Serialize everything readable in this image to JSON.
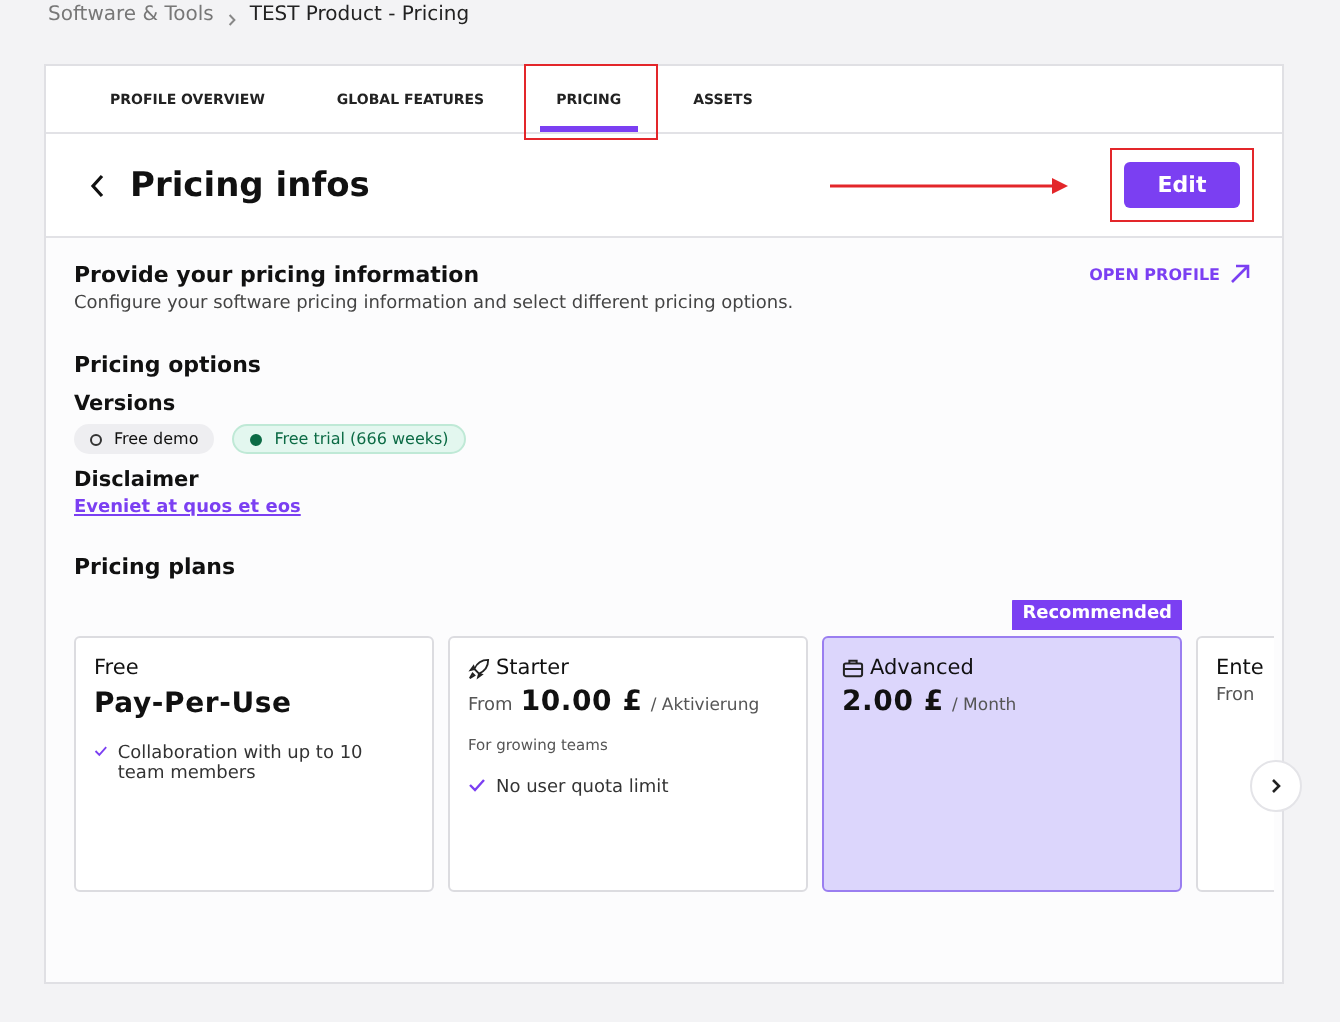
{
  "breadcrumb": [
    {
      "label": "Software & Tools",
      "current": false
    },
    {
      "label": "TEST Product - Pricing",
      "current": true
    }
  ],
  "tabs": [
    {
      "label": "PROFILE OVERVIEW",
      "selected": false
    },
    {
      "label": "GLOBAL FEATURES",
      "selected": false
    },
    {
      "label": "PRICING",
      "selected": true,
      "highlighted": true
    },
    {
      "label": "ASSETS",
      "selected": false
    }
  ],
  "header": {
    "title": "Pricing infos",
    "edit_button": "Edit",
    "edit_highlighted": true
  },
  "intro": {
    "title": "Provide your pricing information",
    "text": "Configure your software pricing information and select different pricing options.",
    "link": "OPEN PROFILE"
  },
  "pricing_options": {
    "title": "Pricing options",
    "versions_title": "Versions",
    "versions": [
      {
        "label": "Free demo",
        "active": false
      },
      {
        "label": "Free trial (666 weeks)",
        "active": true
      }
    ],
    "disclaimer_title": "Disclaimer",
    "disclaimer_link": "Eveniet at quos et eos"
  },
  "plans_title": "Pricing plans",
  "plans": [
    {
      "kind": "free",
      "name": "Free",
      "price": "Pay-Per-Use",
      "features": [
        "Collaboration with up to 10 team members"
      ],
      "selected": false
    },
    {
      "kind": "priced",
      "name": "Starter",
      "prefix": "From",
      "price": "10.00 £",
      "unit": "/ Aktivierung",
      "description": "For growing teams",
      "features": [
        "No user quota limit"
      ],
      "selected": false
    },
    {
      "kind": "priced",
      "name": "Advanced",
      "price": "2.00 £",
      "unit": "/ Month",
      "badge": "Recommended",
      "selected": true
    },
    {
      "kind": "priced",
      "name": "Ente",
      "prefix": "Fron",
      "selected": false
    }
  ]
}
